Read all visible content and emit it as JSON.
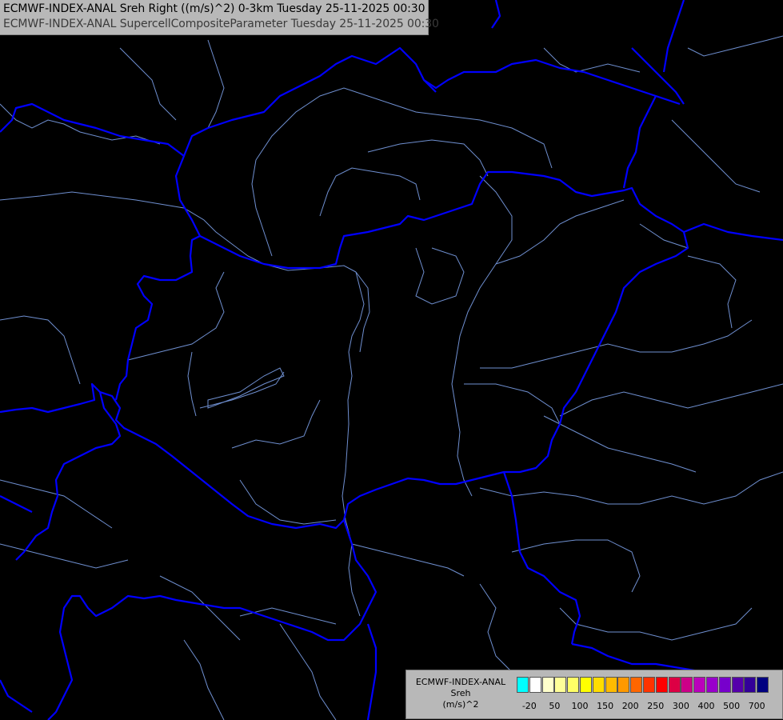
{
  "header": {
    "line1": "ECMWF-INDEX-ANAL Sreh Right ((m/s)^2) 0-3km Tuesday 25-11-2025 00:30",
    "line2": "ECMWF-INDEX-ANAL SupercellCompositeParameter Tuesday 25-11-2025 00:30"
  },
  "legend": {
    "source": "ECMWF-INDEX-ANAL",
    "parameter": "Sreh",
    "unit": "(m/s)^2",
    "colors": [
      "#00ffff",
      "#ffffff",
      "#ffffcc",
      "#ffff99",
      "#ffff66",
      "#ffff00",
      "#ffdd00",
      "#ffbb00",
      "#ff9900",
      "#ff6600",
      "#ff3300",
      "#ff0000",
      "#dd0044",
      "#cc0088",
      "#bb00bb",
      "#9900cc",
      "#7700cc",
      "#5500aa",
      "#330099",
      "#000080"
    ],
    "ticks": [
      "-20",
      "50",
      "100",
      "150",
      "200",
      "250",
      "300",
      "400",
      "500",
      "700"
    ]
  },
  "map": {
    "border_color": "#0000ff",
    "river_color": "#6688cc"
  }
}
